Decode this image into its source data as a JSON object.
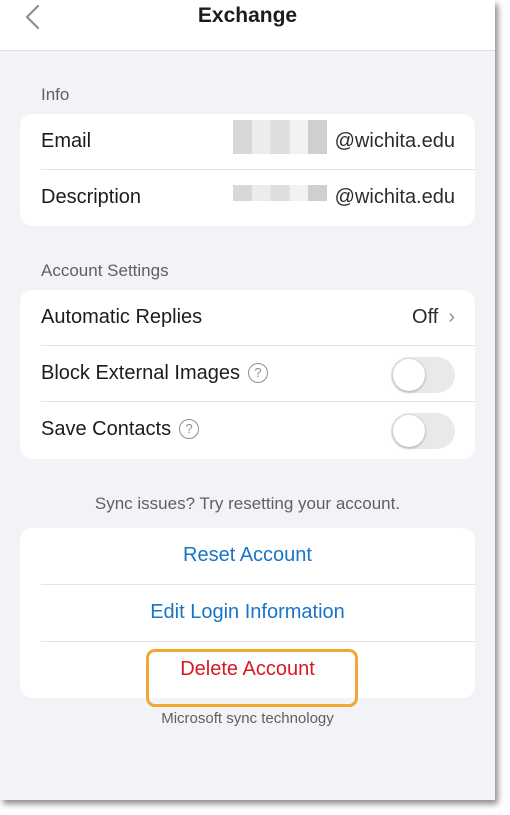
{
  "nav": {
    "title": "Exchange",
    "back_icon": "chevron-left-icon"
  },
  "info": {
    "header": "Info",
    "rows": [
      {
        "label": "Email",
        "value": "@wichita.edu"
      },
      {
        "label": "Description",
        "value": "@wichita.edu"
      }
    ]
  },
  "account_settings": {
    "header": "Account Settings",
    "automatic_replies": {
      "label": "Automatic Replies",
      "value": "Off",
      "chevron": "›"
    },
    "block_external_images": {
      "label": "Block External Images",
      "help": "?",
      "on": false
    },
    "save_contacts": {
      "label": "Save Contacts",
      "help": "?",
      "on": false
    }
  },
  "sync_note": "Sync issues? Try resetting your account.",
  "actions": {
    "reset": "Reset Account",
    "edit_login": "Edit Login Information",
    "delete": "Delete Account"
  },
  "footer_note": "Microsoft sync technology",
  "colors": {
    "link": "#1a73c7",
    "danger": "#d71920",
    "highlight": "#f1a832",
    "background": "#f2f2f7"
  }
}
